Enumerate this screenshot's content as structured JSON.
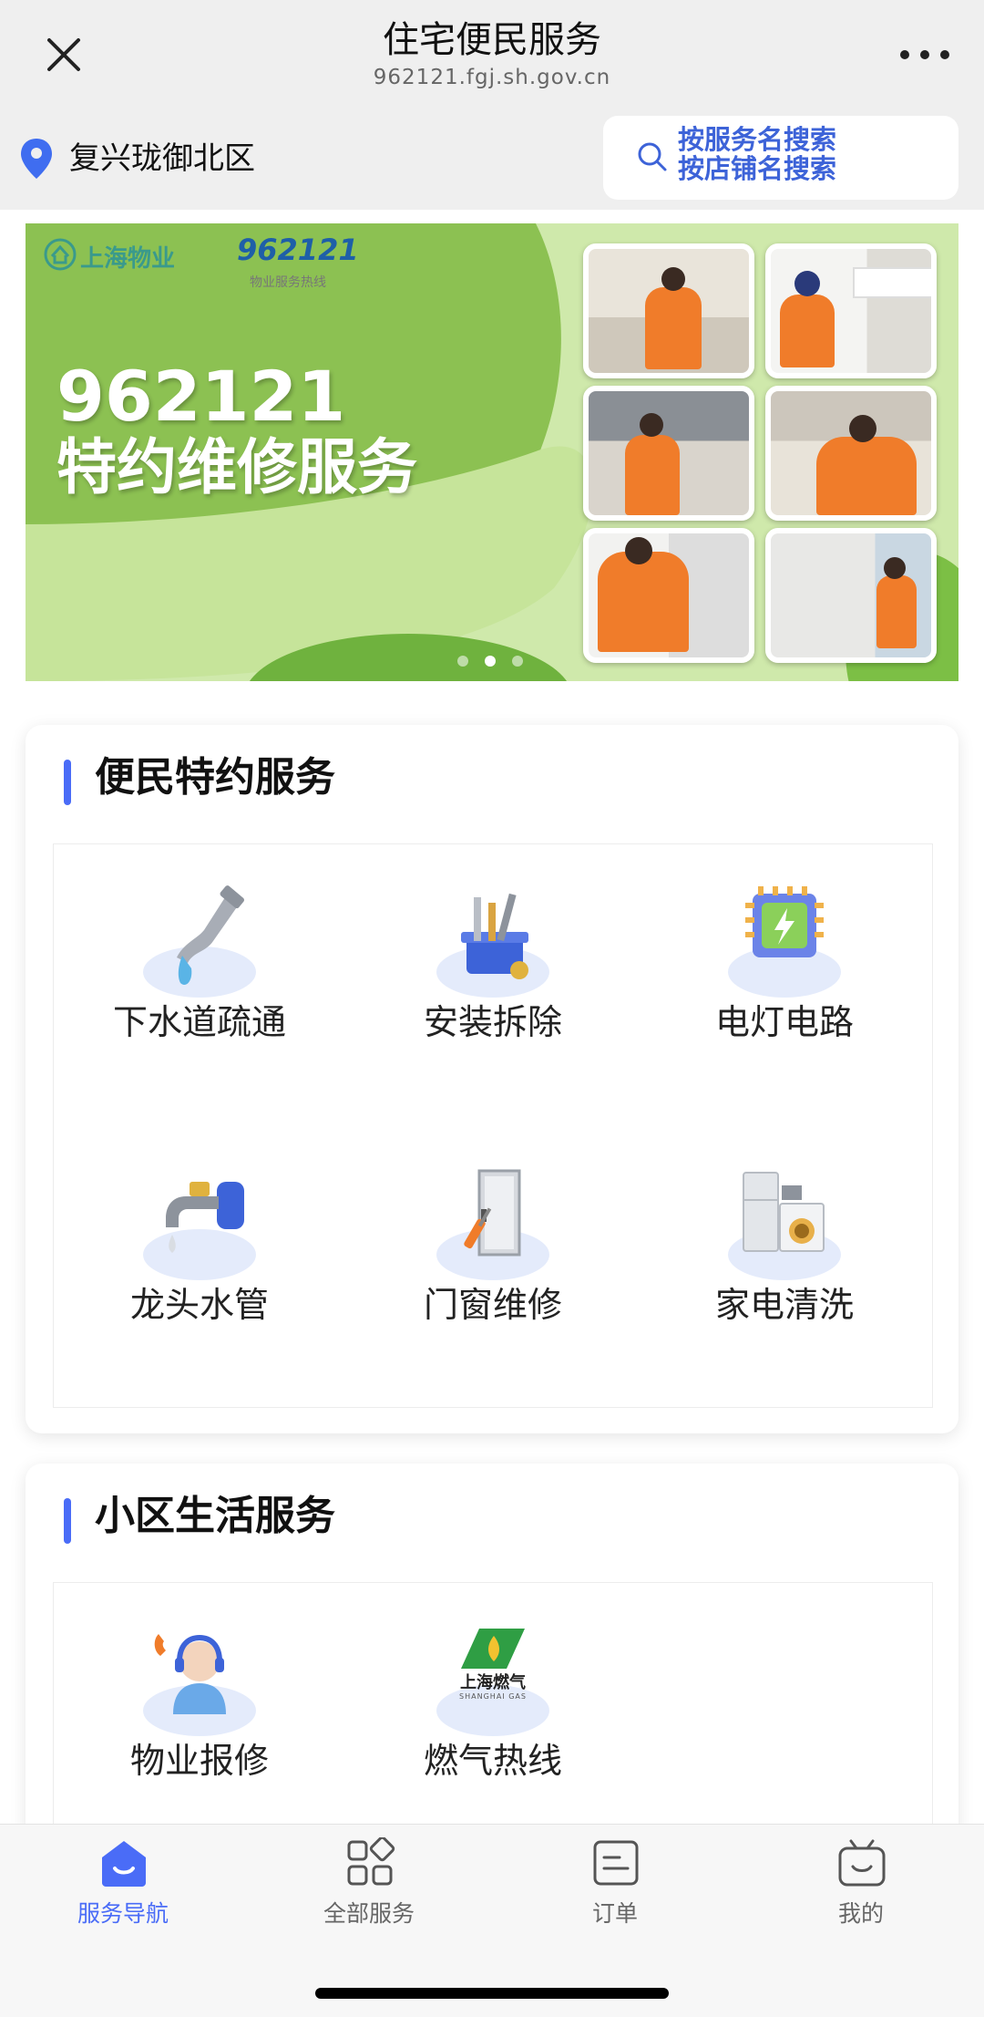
{
  "header": {
    "title": "住宅便民服务",
    "subtitle": "962121.fgj.sh.gov.cn",
    "close_icon": "close-icon",
    "more_icon": "more-icon"
  },
  "location": {
    "name": "复兴珑御北区",
    "icon": "location-pin-icon"
  },
  "search": {
    "line1": "按服务名搜索",
    "line2": "按店铺名搜索",
    "icon": "search-icon"
  },
  "banner": {
    "logo1": "上海物业",
    "logo2": "962121",
    "logo2_sub": "物业服务热线",
    "headline1": "962121",
    "headline2": "特约维修服务",
    "slides": 3,
    "active_slide": 2
  },
  "section1": {
    "title": "便民特约服务",
    "items": [
      {
        "label": "下水道疏通",
        "icon": "drain-pipe-icon"
      },
      {
        "label": "安装拆除",
        "icon": "toolbox-icon"
      },
      {
        "label": "电灯电路",
        "icon": "circuit-chip-icon"
      },
      {
        "label": "龙头水管",
        "icon": "faucet-icon"
      },
      {
        "label": "门窗维修",
        "icon": "door-icon"
      },
      {
        "label": "家电清洗",
        "icon": "appliance-icon"
      }
    ]
  },
  "section2": {
    "title": "小区生活服务",
    "items": [
      {
        "label": "物业报修",
        "icon": "customer-service-icon"
      },
      {
        "label": "燃气热线",
        "icon": "shanghai-gas-logo",
        "logo_text": "上海燃气",
        "logo_sub": "SHANGHAI GAS"
      }
    ]
  },
  "tabs": [
    {
      "label": "服务导航",
      "icon": "home-icon",
      "active": true
    },
    {
      "label": "全部服务",
      "icon": "grid-icon",
      "active": false
    },
    {
      "label": "订单",
      "icon": "order-icon",
      "active": false
    },
    {
      "label": "我的",
      "icon": "profile-icon",
      "active": false
    }
  ],
  "colors": {
    "accent": "#4a6cf7",
    "banner_green": "#8cc152"
  }
}
